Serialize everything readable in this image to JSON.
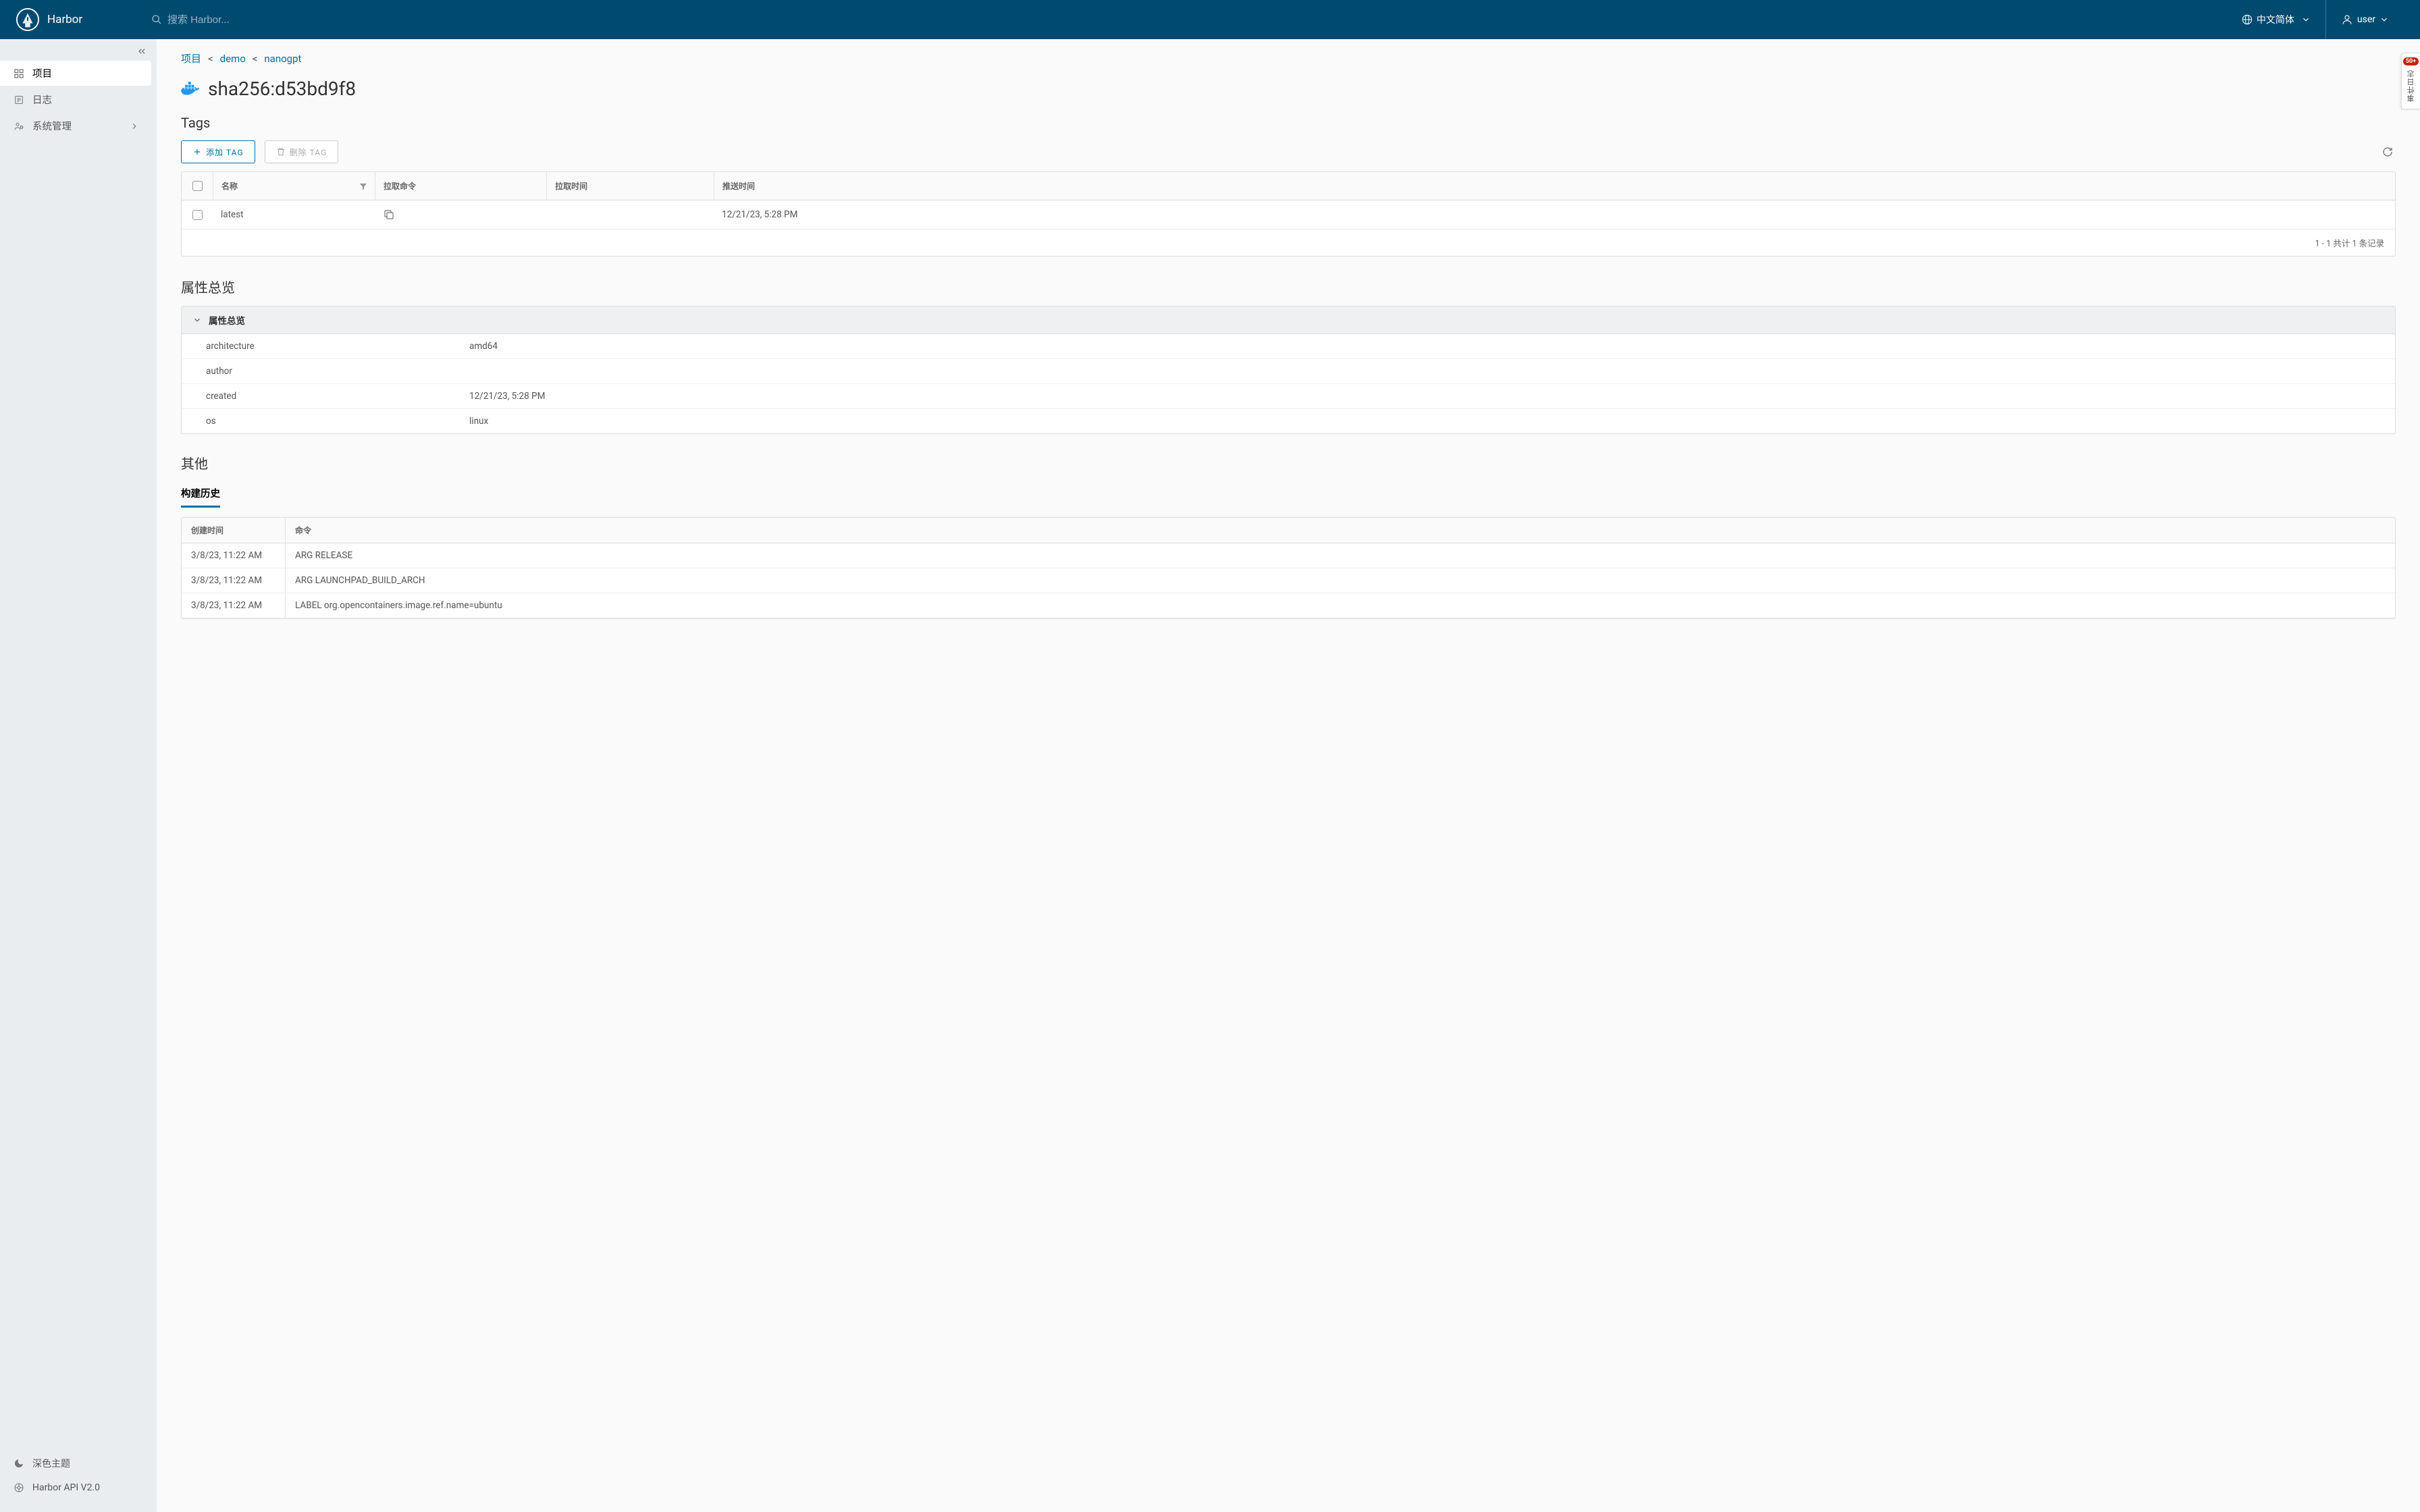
{
  "header": {
    "brand": "Harbor",
    "search_placeholder": "搜索 Harbor...",
    "lang": "中文简体",
    "user": "user"
  },
  "sidebar": {
    "items": [
      {
        "label": "项目",
        "icon": "grid-icon",
        "active": true
      },
      {
        "label": "日志",
        "icon": "list-icon",
        "active": false
      },
      {
        "label": "系统管理",
        "icon": "admin-icon",
        "active": false,
        "expandable": true
      }
    ],
    "bottom": {
      "theme": "深色主题",
      "api": "Harbor API V2.0"
    }
  },
  "breadcrumbs": {
    "root": "项目",
    "project": "demo",
    "repo": "nanogpt"
  },
  "artifact": {
    "digest": "sha256:d53bd9f8"
  },
  "tags_section": {
    "title": "Tags",
    "add_label": "添加 TAG",
    "remove_label": "删除 TAG",
    "columns": {
      "name": "名称",
      "pull_cmd": "拉取命令",
      "pull_time": "拉取时间",
      "push_time": "推送时间"
    },
    "rows": [
      {
        "name": "latest",
        "pull_cmd": "",
        "pull_time": "",
        "push_time": "12/21/23, 5:28 PM"
      }
    ],
    "footer": "1 - 1 共计 1 条记录"
  },
  "overview": {
    "title": "属性总览",
    "acc_title": "属性总览",
    "rows": [
      {
        "k": "architecture",
        "v": "amd64"
      },
      {
        "k": "author",
        "v": ""
      },
      {
        "k": "created",
        "v": "12/21/23, 5:28 PM"
      },
      {
        "k": "os",
        "v": "linux"
      }
    ]
  },
  "others": {
    "title": "其他",
    "tab": "构建历史",
    "columns": {
      "created": "创建时间",
      "cmd": "命令"
    },
    "rows": [
      {
        "t": "3/8/23, 11:22 AM",
        "c": "ARG RELEASE"
      },
      {
        "t": "3/8/23, 11:22 AM",
        "c": "ARG LAUNCHPAD_BUILD_ARCH"
      },
      {
        "t": "3/8/23, 11:22 AM",
        "c": "LABEL org.opencontainers.image.ref.name=ubuntu"
      }
    ]
  },
  "side_badge": {
    "count": "50+",
    "label": "事件日志"
  }
}
